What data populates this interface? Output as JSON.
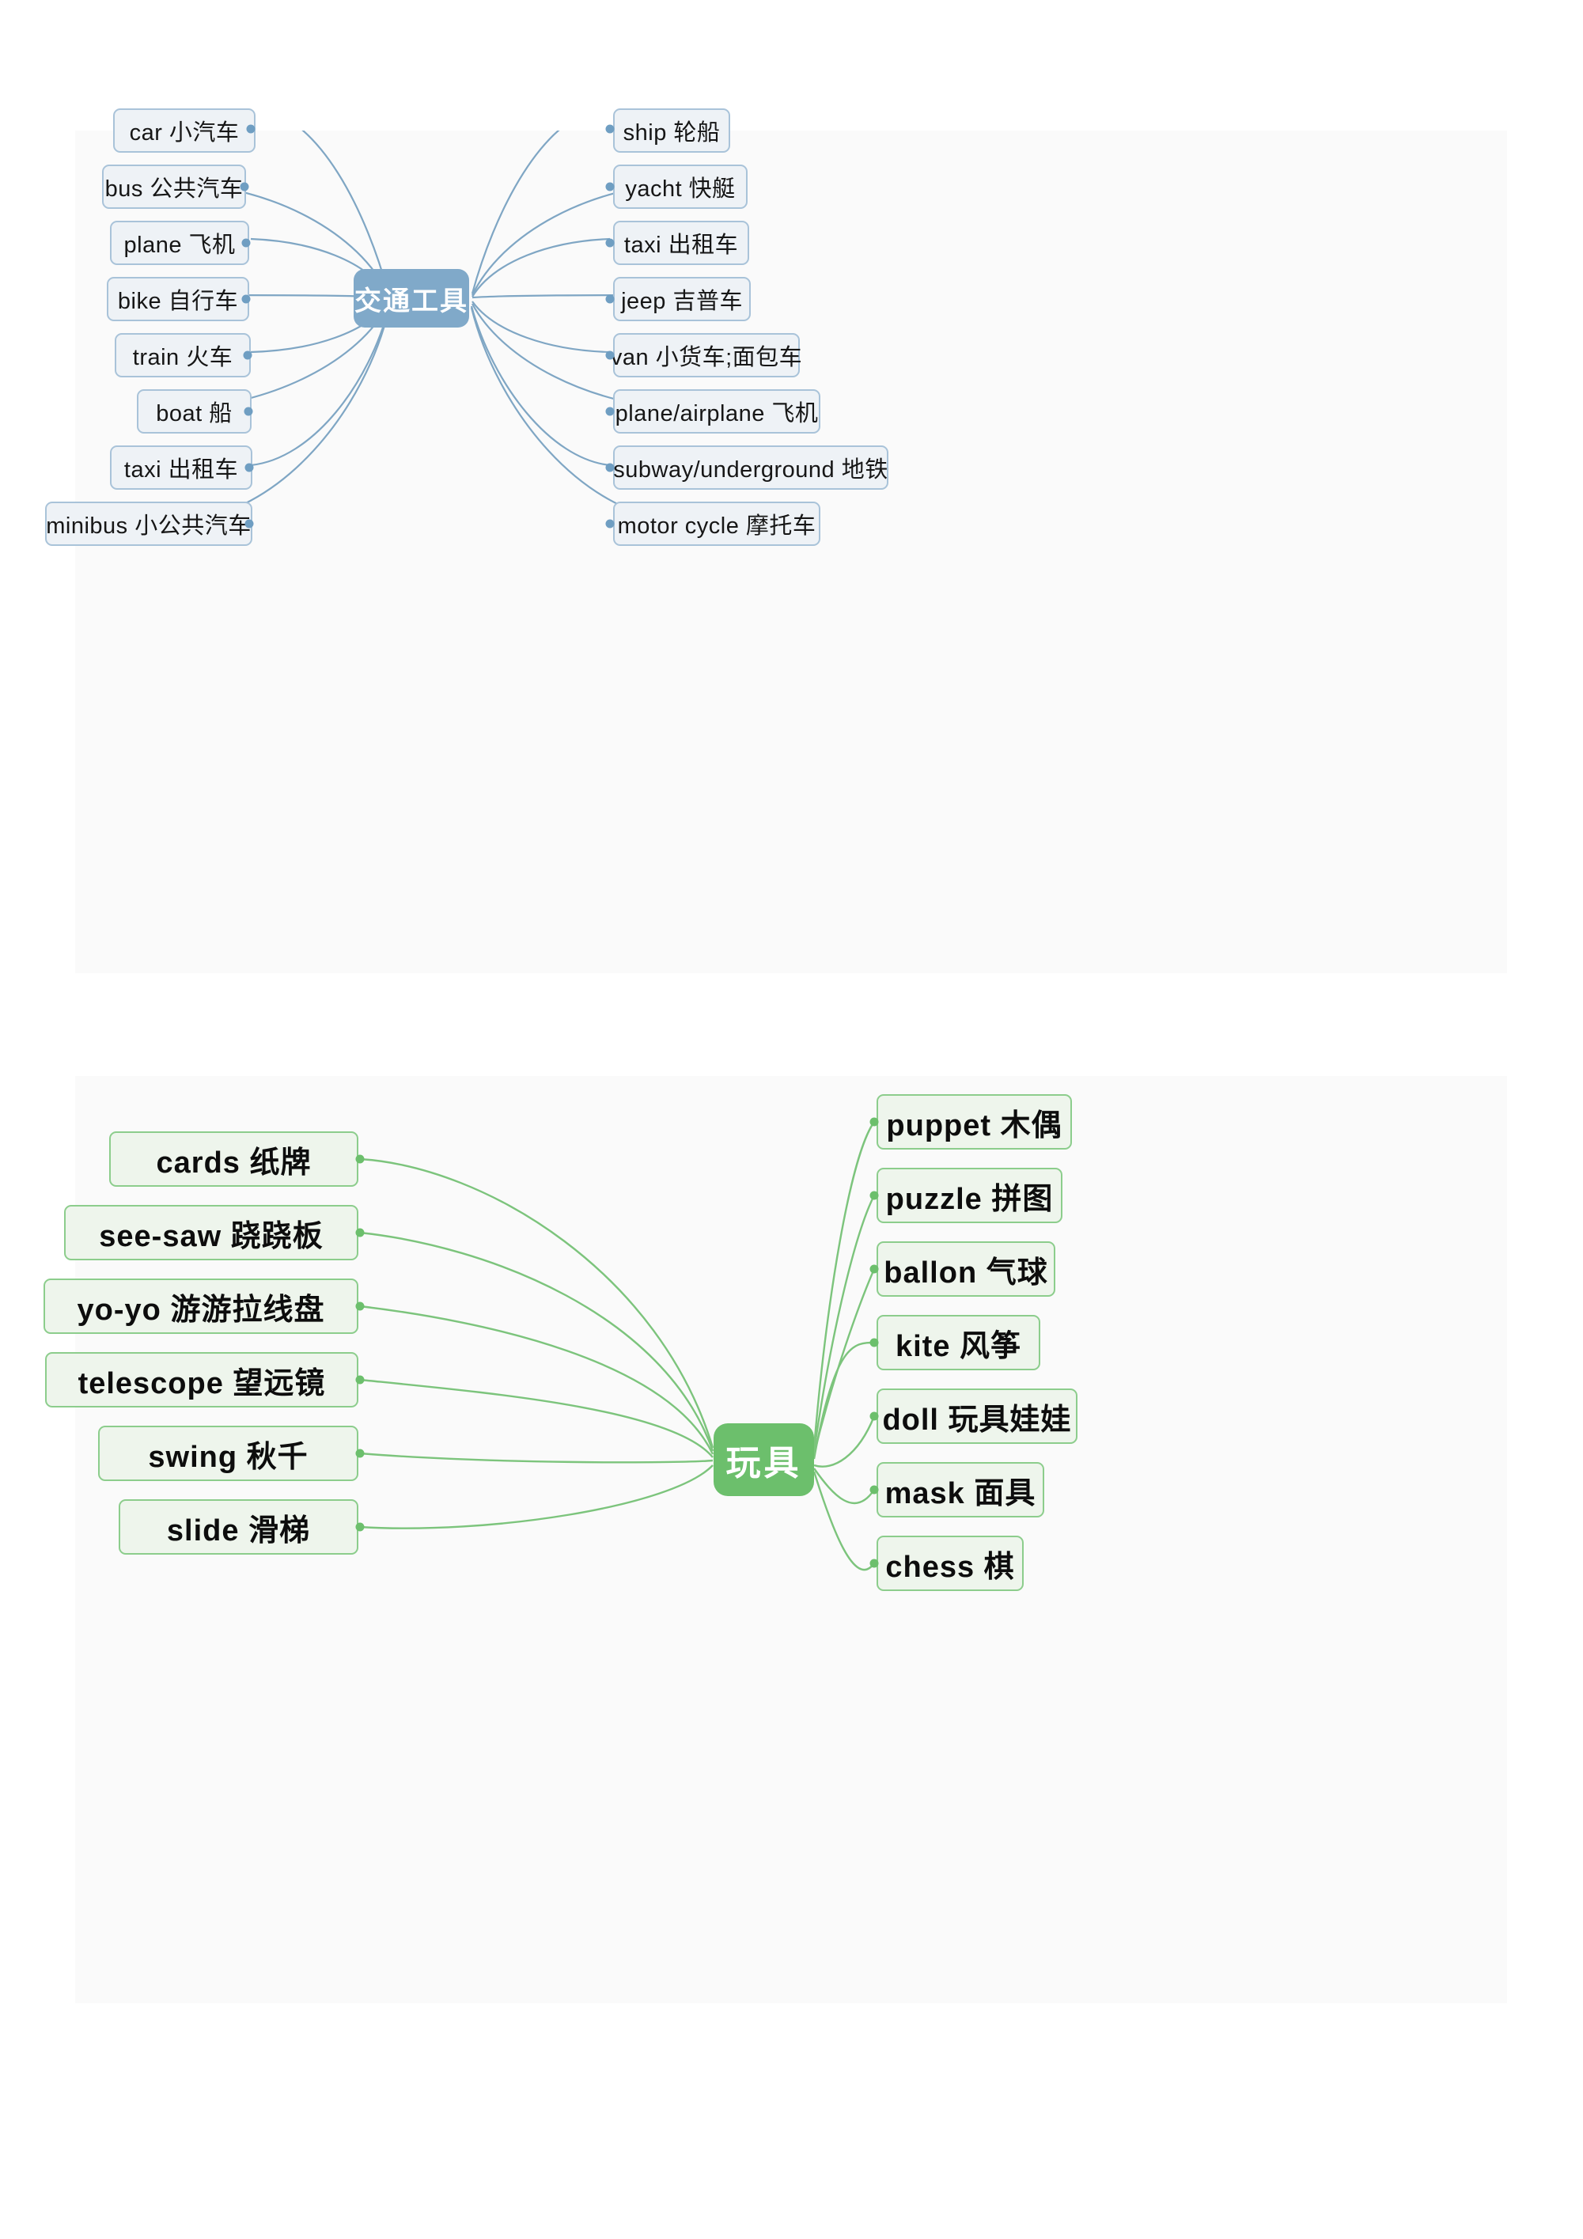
{
  "diagrams": [
    {
      "id": "transport",
      "accent": "#80a9c9",
      "box_fill": "#eef2f6",
      "box_border": "#a9c3d9",
      "root": {
        "label": "交通工具"
      },
      "left_nodes": [
        {
          "label": "car  小汽车"
        },
        {
          "label": "bus  公共汽车"
        },
        {
          "label": "plane  飞机"
        },
        {
          "label": "bike  自行车"
        },
        {
          "label": "train  火车"
        },
        {
          "label": "boat  船"
        },
        {
          "label": "taxi  出租车"
        },
        {
          "label": "minibus  小公共汽车"
        }
      ],
      "right_nodes": [
        {
          "label": "ship  轮船"
        },
        {
          "label": "yacht  快艇"
        },
        {
          "label": "taxi  出租车"
        },
        {
          "label": "jeep  吉普车"
        },
        {
          "label": "van  小货车;面包车"
        },
        {
          "label": "plane/airplane  飞机"
        },
        {
          "label": "subway/underground  地铁"
        },
        {
          "label": "motor cycle  摩托车"
        }
      ]
    },
    {
      "id": "toys",
      "accent": "#6cbf6c",
      "box_fill": "#eef5ec",
      "box_border": "#8ccd8c",
      "root": {
        "label": "玩具"
      },
      "left_nodes": [
        {
          "label": "cards  纸牌"
        },
        {
          "label": "see-saw  跷跷板"
        },
        {
          "label": "yo-yo  游游拉线盘"
        },
        {
          "label": "telescope  望远镜"
        },
        {
          "label": "swing  秋千"
        },
        {
          "label": "slide  滑梯"
        }
      ],
      "right_nodes": [
        {
          "label": "puppet  木偶"
        },
        {
          "label": "puzzle  拼图"
        },
        {
          "label": "ballon  气球"
        },
        {
          "label": "kite  风筝"
        },
        {
          "label": "doll  玩具娃娃"
        },
        {
          "label": "mask  面具"
        },
        {
          "label": "chess  棋"
        }
      ]
    }
  ]
}
